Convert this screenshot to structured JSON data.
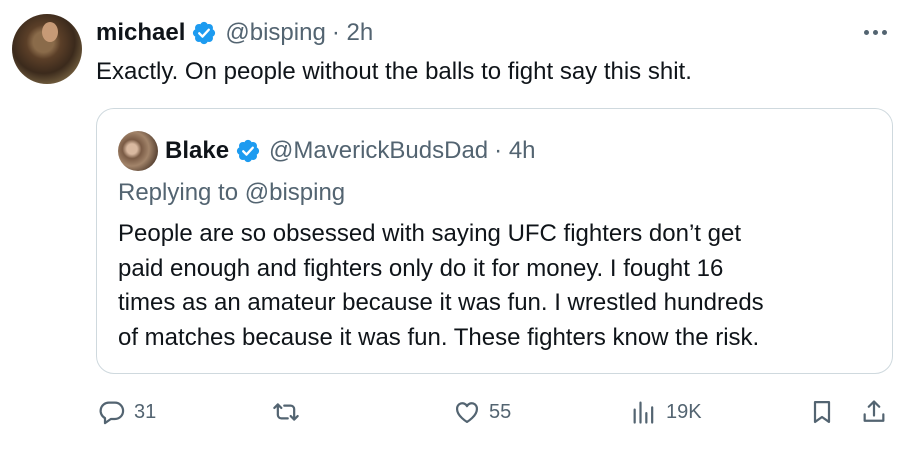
{
  "tweet": {
    "display_name": "michael",
    "handle": "@bisping",
    "time": "· 2h",
    "text": "Exactly. On people without the balls to fight say this shit."
  },
  "quoted_tweet": {
    "display_name": "Blake",
    "handle": "@MaverickBudsDad",
    "time": "· 4h",
    "replying_to": "Replying to @bisping",
    "lines": [
      "People are so obsessed with saying UFC fighters don’t get",
      "paid enough and fighters only do it for money. I fought 16",
      "times as an amateur because it was fun. I wrestled hundreds",
      "of matches because it was fun. These fighters know the risk."
    ]
  },
  "actions": {
    "reply_count": "31",
    "like_count": "55",
    "views_count": "19K"
  },
  "colors": {
    "verified": "#1d9bf0",
    "secondary_text": "#536471",
    "border": "#cfd9de"
  },
  "icons": [
    "more-icon",
    "verified-icon",
    "reply-icon",
    "retweet-icon",
    "like-icon",
    "views-icon",
    "bookmark-icon",
    "share-icon"
  ]
}
